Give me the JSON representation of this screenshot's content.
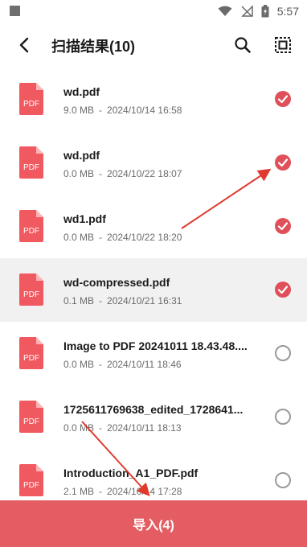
{
  "status_bar": {
    "time": "5:57"
  },
  "header": {
    "title": "扫描结果(10)"
  },
  "files": [
    {
      "name": "wd.pdf",
      "size": "9.0 MB",
      "date": "2024/10/14 16:58",
      "checked": true,
      "highlighted": false
    },
    {
      "name": "wd.pdf",
      "size": "0.0 MB",
      "date": "2024/10/22 18:07",
      "checked": true,
      "highlighted": false
    },
    {
      "name": "wd1.pdf",
      "size": "0.0 MB",
      "date": "2024/10/22 18:20",
      "checked": true,
      "highlighted": false
    },
    {
      "name": "wd-compressed.pdf",
      "size": "0.1 MB",
      "date": "2024/10/21 16:31",
      "checked": true,
      "highlighted": true
    },
    {
      "name": "Image to PDF 20241011 18.43.48....",
      "size": "0.0 MB",
      "date": "2024/10/11 18:46",
      "checked": false,
      "highlighted": false
    },
    {
      "name": "1725611769638_edited_1728641...",
      "size": "0.0 MB",
      "date": "2024/10/11 18:13",
      "checked": false,
      "highlighted": false
    },
    {
      "name": "Introduction_A1_PDF.pdf",
      "size": "2.1 MB",
      "date": "2024/10/14 17:28",
      "checked": false,
      "highlighted": false
    }
  ],
  "pdf_icon_label": "PDF",
  "meta_separator": "-",
  "import_button": {
    "label": "导入(4)"
  },
  "colors": {
    "accent": "#e35d62",
    "check_on": "#e0505a",
    "pdf_icon": "#f0595f",
    "annotation_arrow": "#e03a2f"
  }
}
